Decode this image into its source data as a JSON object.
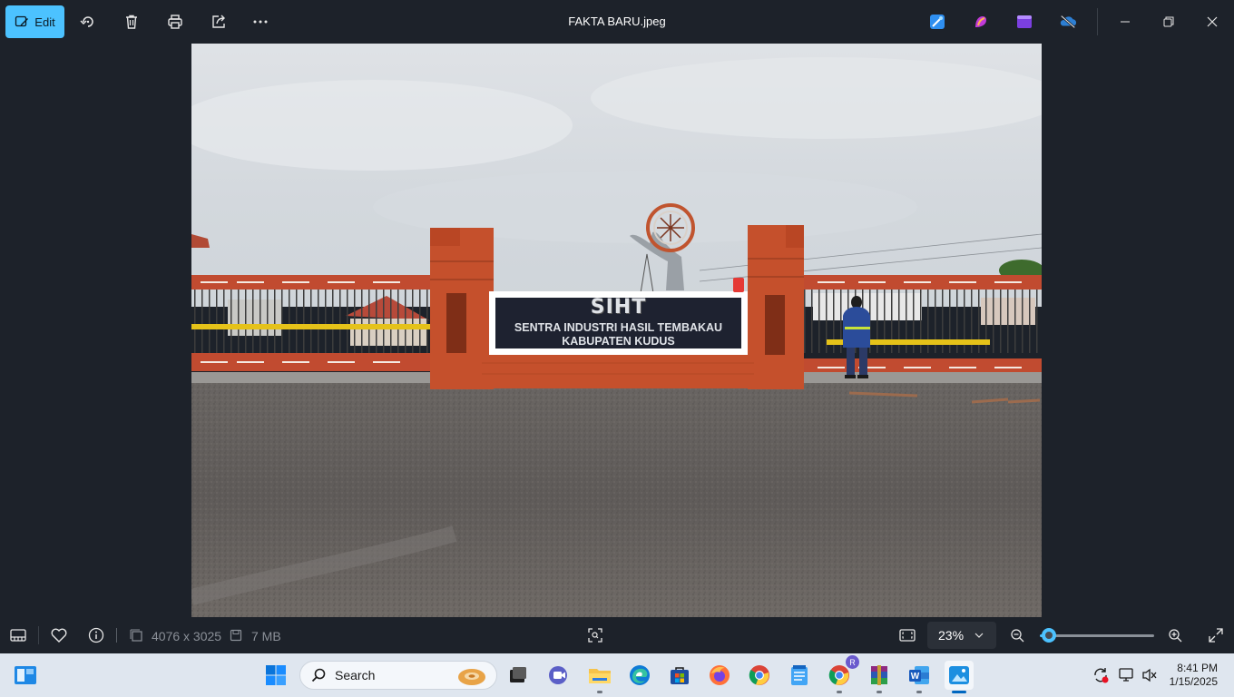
{
  "toolbar": {
    "edit_label": "Edit",
    "file_title": "FAKTA BARU.jpeg",
    "icons": [
      "rotate-icon",
      "delete-icon",
      "print-icon",
      "share-icon",
      "more-icon"
    ],
    "app_icons": [
      "designer-icon",
      "copilot-icon",
      "clipchamp-icon",
      "onedrive-off-icon"
    ],
    "window_controls": [
      "minimize-icon",
      "restore-icon",
      "close-icon"
    ]
  },
  "photo": {
    "sign_title": "SIHT",
    "sign_line1": "SENTRA INDUSTRI HASIL TEMBAKAU",
    "sign_line2": "KABUPATEN KUDUS"
  },
  "statusbar": {
    "dimensions": "4076 x 3025",
    "filesize": "7 MB",
    "zoom": "23%",
    "zoom_fraction": 0.05
  },
  "taskbar": {
    "search_placeholder": "Search",
    "apps": [
      "start",
      "search",
      "task-view",
      "teams-meet",
      "file-explorer",
      "edge",
      "store",
      "firefox",
      "chrome",
      "notepad",
      "chrome-profile",
      "winrar",
      "word",
      "photos"
    ],
    "profile_badge": "R",
    "time": "8:41 PM",
    "date": "1/15/2025"
  },
  "colors": {
    "accent": "#4cc2ff",
    "background": "#1d222a",
    "taskbar": "#dfe6ef",
    "brick": "#c5502c"
  }
}
